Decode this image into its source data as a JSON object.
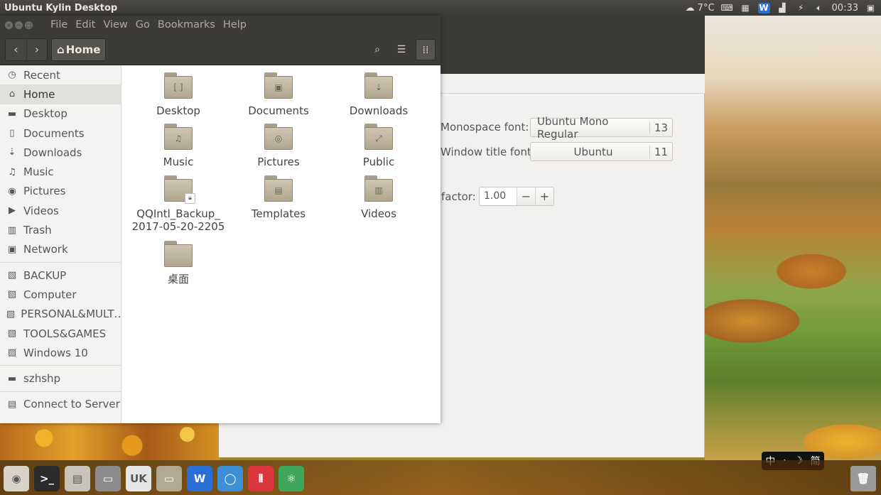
{
  "panel": {
    "title": "Ubuntu Kylin Desktop",
    "weather_icon": "cloud-icon",
    "temperature": "7°C",
    "time": "00:33"
  },
  "nautilus": {
    "menu": [
      "File",
      "Edit",
      "View",
      "Go",
      "Bookmarks",
      "Help"
    ],
    "path_label": "Home",
    "sidebar": [
      {
        "label": "Recent",
        "icon": "recent-icon"
      },
      {
        "label": "Home",
        "icon": "home-icon",
        "selected": true
      },
      {
        "label": "Desktop",
        "icon": "folder-icon"
      },
      {
        "label": "Documents",
        "icon": "document-icon"
      },
      {
        "label": "Downloads",
        "icon": "download-icon"
      },
      {
        "label": "Music",
        "icon": "music-icon"
      },
      {
        "label": "Pictures",
        "icon": "camera-icon"
      },
      {
        "label": "Videos",
        "icon": "video-icon"
      },
      {
        "label": "Trash",
        "icon": "trash-icon"
      },
      {
        "label": "Network",
        "icon": "network-icon"
      },
      {
        "label": "BACKUP",
        "icon": "drive-icon"
      },
      {
        "label": "Computer",
        "icon": "drive-icon"
      },
      {
        "label": "PERSONAL&MULT…",
        "icon": "drive-icon"
      },
      {
        "label": "TOOLS&GAMES",
        "icon": "drive-icon"
      },
      {
        "label": "Windows 10",
        "icon": "drive-icon"
      },
      {
        "label": "szhshp",
        "icon": "folder-icon"
      },
      {
        "label": "Connect to Server",
        "icon": "server-icon"
      }
    ],
    "files": [
      {
        "name": "Desktop",
        "emblem": "[ ]"
      },
      {
        "name": "Documents",
        "emblem": "▣"
      },
      {
        "name": "Downloads",
        "emblem": "⇣"
      },
      {
        "name": "Music",
        "emblem": "♫"
      },
      {
        "name": "Pictures",
        "emblem": "◎"
      },
      {
        "name": "Public",
        "emblem": "⤢"
      },
      {
        "name": "QQIntl_Backup_\n2017-05-20-2205",
        "emblem": "",
        "locked": true
      },
      {
        "name": "Templates",
        "emblem": "▤"
      },
      {
        "name": "Videos",
        "emblem": "▥"
      },
      {
        "name": "桌面",
        "emblem": ""
      }
    ]
  },
  "settings": {
    "mono_label": "Monospace font:",
    "mono_font": "Ubuntu Mono Regular",
    "mono_size": "13",
    "title_label": "Window title font:",
    "title_font": "Ubuntu",
    "title_size": "11",
    "factor_label": "factor:",
    "factor_value": "1.00",
    "minus": "−",
    "plus": "+"
  },
  "ime": {
    "lang": "中",
    "dot": "·",
    "moon": "☽",
    "mode": "简"
  },
  "launcher": [
    {
      "name": "dash-icon",
      "color": "#d8d2c8",
      "glyph": "◉"
    },
    {
      "name": "terminal-icon",
      "color": "#2b2b2b",
      "glyph": ">_"
    },
    {
      "name": "files-manager-icon",
      "color": "#c9c4bb",
      "glyph": "▤"
    },
    {
      "name": "photo-icon",
      "color": "#8c8c8c",
      "glyph": "▭"
    },
    {
      "name": "software-center-icon",
      "color": "#e6e6e6",
      "glyph": "UK"
    },
    {
      "name": "folder-icon",
      "color": "#b3a993",
      "glyph": "▭"
    },
    {
      "name": "wps-writer-icon",
      "color": "#2a6fd6",
      "glyph": "W"
    },
    {
      "name": "chromium-icon",
      "color": "#3f8fd8",
      "glyph": "◯"
    },
    {
      "name": "mixer-icon",
      "color": "#d9363e",
      "glyph": "⦀"
    },
    {
      "name": "atom-icon",
      "color": "#3fa65c",
      "glyph": "⚛"
    }
  ],
  "trash_icon": "trash-icon"
}
